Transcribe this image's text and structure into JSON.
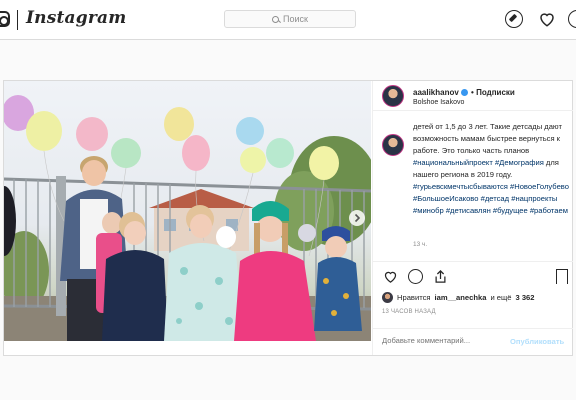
{
  "nav": {
    "brand": "Instagram",
    "search_placeholder": "Поиск",
    "icons": [
      "instagram-glyph-icon",
      "search-icon",
      "explore-compass-icon",
      "heart-icon",
      "profile-icon"
    ]
  },
  "post": {
    "username": "aaalikhanov",
    "verified": true,
    "separator": "•",
    "follow_status": "Подписки",
    "location": "Bolshoe Isakovo",
    "caption_text": "детей от 1,5 до 3 лет. Такие детсады дают возможность мамам быстрее вернуться к работе. Это только часть планов ",
    "caption_tail": " для нашего региона в 2019 году.",
    "hashtags": {
      "h1": "#национальныйпроект",
      "h2": "#Демография",
      "h3": "#гурьевскмечтысбываются",
      "h4": "#НовоеГолубево",
      "h5": "#БольшоеИсаково",
      "h6": "#детсад",
      "h7": "#нацпроекты",
      "h8": "#минобр",
      "h9": "#детисавлян",
      "h10": "#будущее",
      "h11": "#работаем"
    },
    "relative_time": "13 ч.",
    "likes_prefix": "Нравится",
    "liker": "iam__anechka",
    "likes_middle": "и ещё",
    "likes_count": "3 362",
    "timestamp": "13 ЧАСОВ НАЗАД",
    "comment_placeholder": "Добавьте комментарий...",
    "publish_label": "Опубликовать",
    "publish_color": "#b2dffc",
    "link_color": "#003569"
  }
}
